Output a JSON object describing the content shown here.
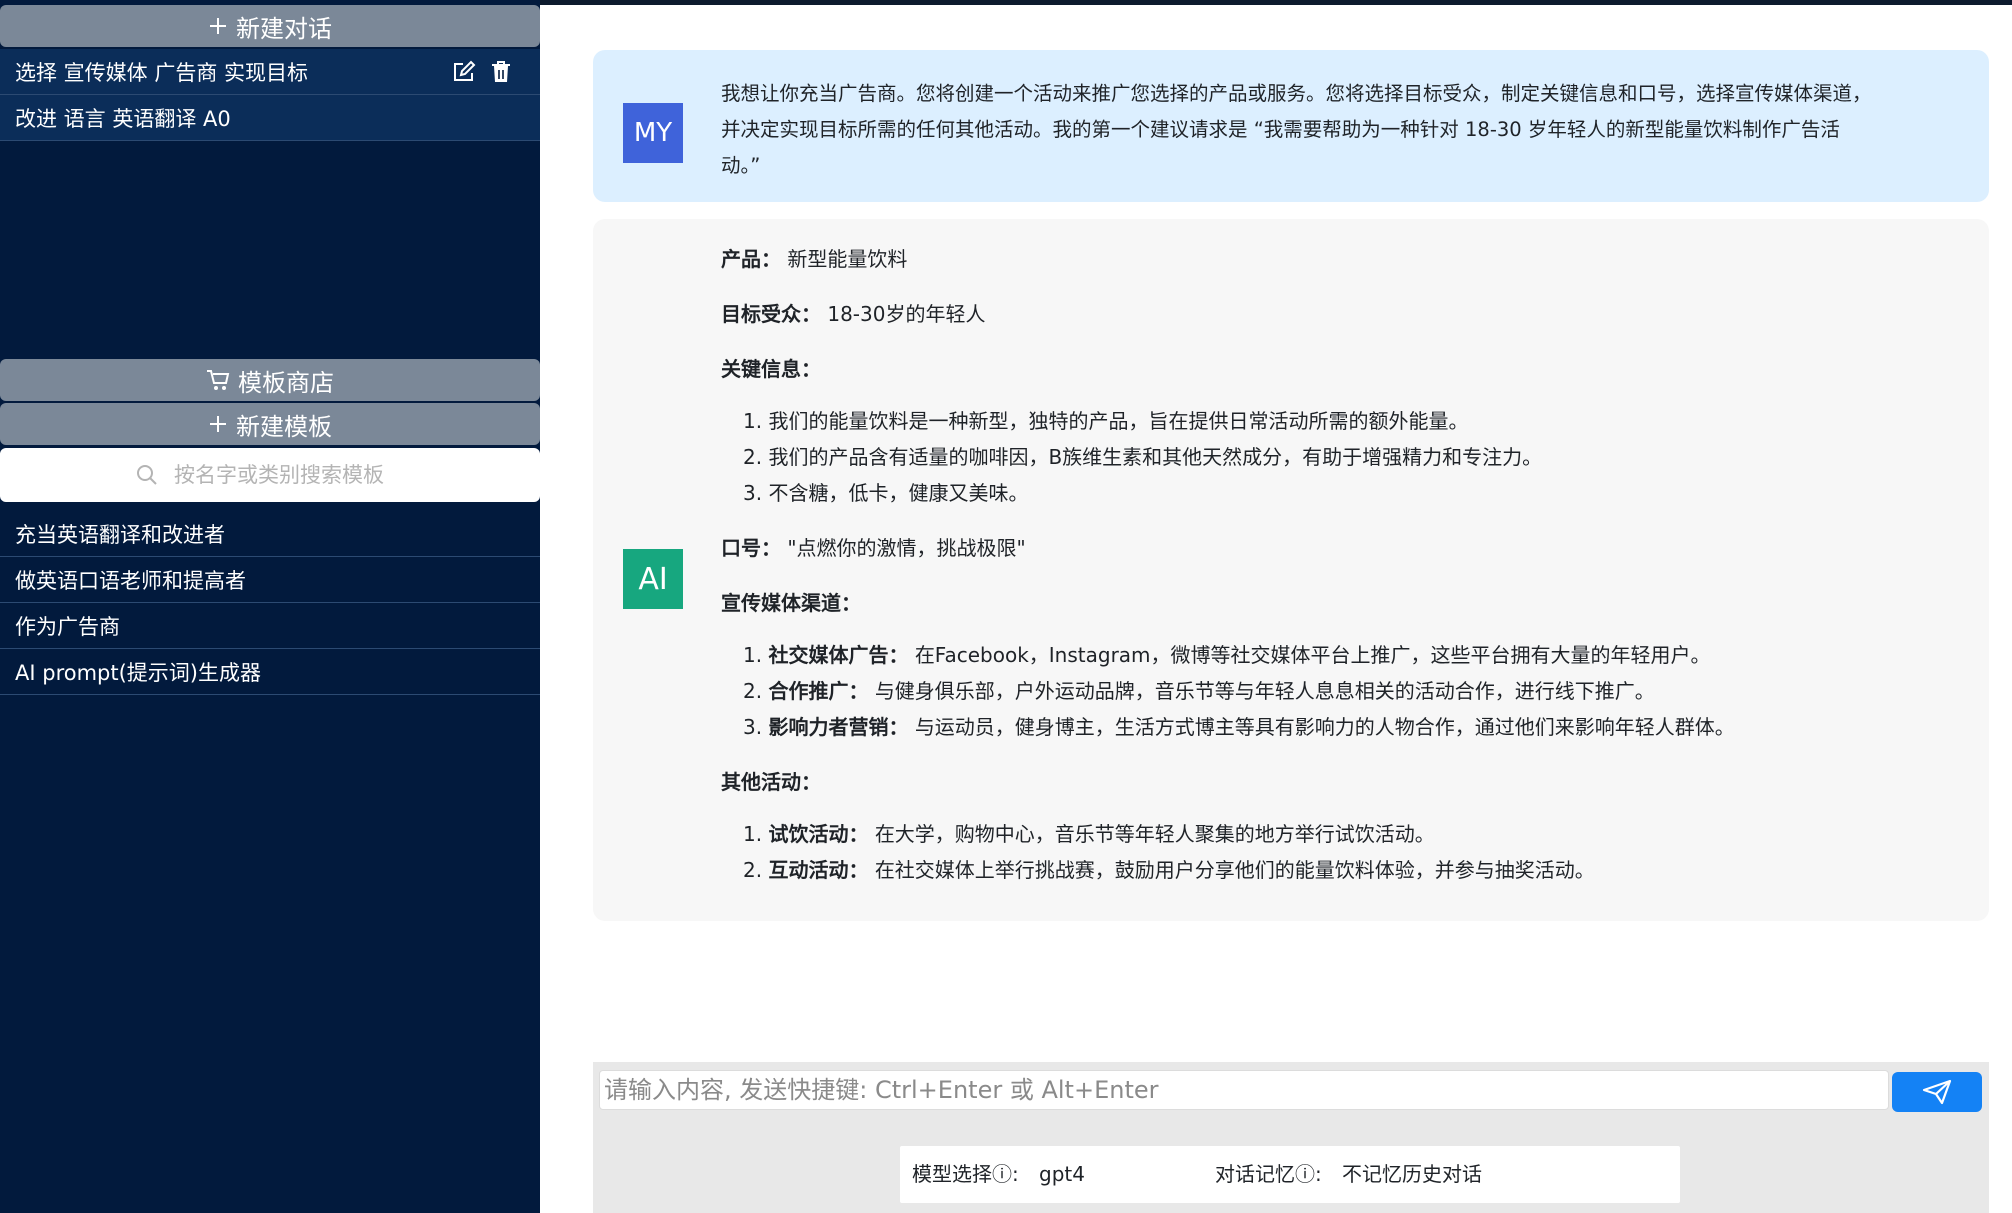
{
  "sidebar": {
    "new_chat_label": "新建对话",
    "conversations": [
      {
        "title": "选择 宣传媒体 广告商 实现目标"
      },
      {
        "title": "改进 语言 英语翻译 A0"
      }
    ],
    "template_store_label": "模板商店",
    "new_template_label": "新建模板",
    "search_placeholder": "按名字或类别搜索模板",
    "templates": [
      {
        "title": "充当英语翻译和改进者"
      },
      {
        "title": "做英语口语老师和提高者"
      },
      {
        "title": "作为广告商"
      },
      {
        "title": "AI prompt(提示词)生成器"
      }
    ]
  },
  "chat": {
    "user_avatar": "MY",
    "user_message_lines": [
      "我想让你充当广告商。您将创建一个活动来推广您选择的产品或服务。您将选择目标受众，制定关键信息和口号，选择宣传媒体渠道，",
      "并决定实现目标所需的任何其他活动。我的第一个建议请求是 “我需要帮助为一种针对 18-30 岁年轻人的新型能量饮料制作广告活",
      "动。”"
    ],
    "ai_avatar": "AI",
    "ai_reply": {
      "product_label": "产品：",
      "product": "新型能量饮料",
      "audience_label": "目标受众：",
      "audience": "18-30岁的年轻人",
      "key_message_label": "关键信息：",
      "key_messages": [
        "1. 我们的能量饮料是一种新型，独特的产品，旨在提供日常活动所需的额外能量。",
        "2. 我们的产品含有适量的咖啡因，B族维生素和其他天然成分，有助于增强精力和专注力。",
        "3. 不含糖，低卡，健康又美味。"
      ],
      "slogan_label": "口号：",
      "slogan": "\"点燃你的激情，挑战极限\"",
      "channels_label": "宣传媒体渠道：",
      "channels": [
        {
          "num": "1. ",
          "title": "社交媒体广告：",
          "text": "在Facebook，Instagram，微博等社交媒体平台上推广，这些平台拥有大量的年轻用户。"
        },
        {
          "num": "2. ",
          "title": "合作推广：",
          "text": "与健身俱乐部，户外运动品牌，音乐节等与年轻人息息相关的活动合作，进行线下推广。"
        },
        {
          "num": "3. ",
          "title": "影响力者营销：",
          "text": "与运动员，健身博主，生活方式博主等具有影响力的人物合作，通过他们来影响年轻人群体。"
        }
      ],
      "other_label": "其他活动：",
      "other": [
        {
          "num": "1. ",
          "title": "试饮活动：",
          "text": "在大学，购物中心，音乐节等年轻人聚集的地方举行试饮活动。"
        },
        {
          "num": "2. ",
          "title": "互动活动：",
          "text": "在社交媒体上举行挑战赛，鼓励用户分享他们的能量饮料体验，并参与抽奖活动。"
        }
      ]
    }
  },
  "input": {
    "placeholder": "请输入内容, 发送快捷键: Ctrl+Enter 或 Alt+Enter",
    "model_label": "模型选择ⓘ:",
    "model_value": "gpt4",
    "memory_label": "对话记忆ⓘ:",
    "memory_value": "不记忆历史对话"
  },
  "colors": {
    "sidebar_bg": "#021a3d",
    "sidebar_button": "#7b8898",
    "user_bubble": "#dcefff",
    "ai_bubble": "#f7f7f7",
    "user_avatar": "#3f63da",
    "ai_avatar": "#17a77f",
    "send_button": "#1482f5"
  },
  "icons": {
    "new_chat": "plus-icon",
    "edit": "edit-icon",
    "delete": "trash-icon",
    "store": "cart-icon",
    "new_template": "plus-icon",
    "search": "search-icon",
    "send": "send-icon"
  }
}
